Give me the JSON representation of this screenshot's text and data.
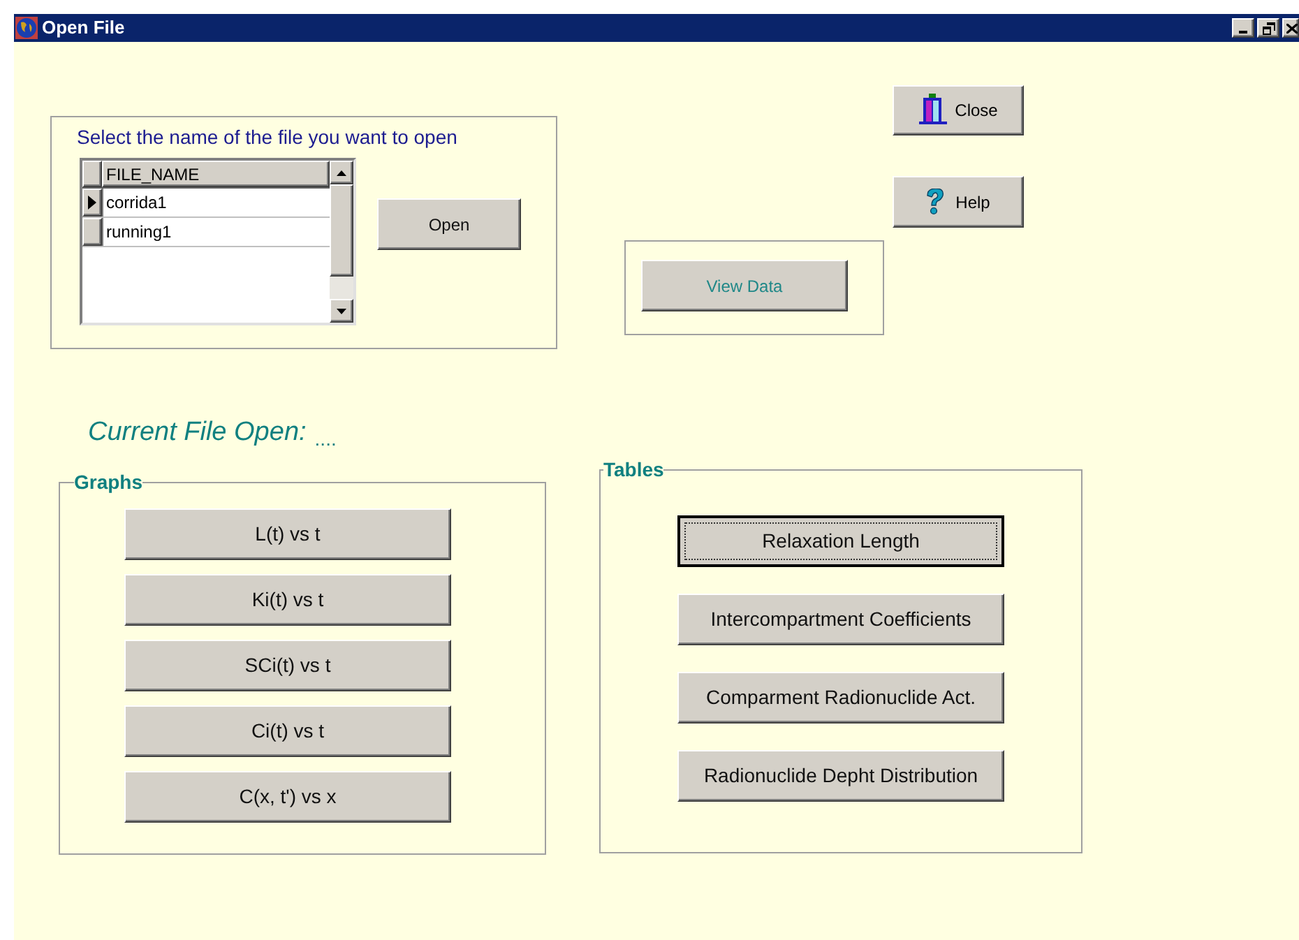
{
  "window": {
    "title": "Open File"
  },
  "file_picker": {
    "prompt": "Select the name of the file you want to open",
    "grid": {
      "columns": [
        "FILE_NAME"
      ],
      "rows": [
        {
          "cells": [
            "corrida1"
          ],
          "selected": true
        },
        {
          "cells": [
            "running1"
          ],
          "selected": false
        }
      ]
    },
    "open_button": "Open"
  },
  "view_data_button": "View Data",
  "close_button": "Close",
  "help_button": "Help",
  "current_file": {
    "label": "Current File Open:",
    "value": "...."
  },
  "graphs": {
    "title": "Graphs",
    "buttons": [
      {
        "label": "L(t) vs t",
        "selected": false
      },
      {
        "label": "Ki(t) vs t",
        "selected": false
      },
      {
        "label": "SCi(t) vs t",
        "selected": false
      },
      {
        "label": "Ci(t) vs t",
        "selected": false
      },
      {
        "label": "C(x, t') vs x",
        "selected": false
      }
    ]
  },
  "tables": {
    "title": "Tables",
    "buttons": [
      {
        "label": "Relaxation Length",
        "selected": true
      },
      {
        "label": "Intercompartment Coefficients",
        "selected": false
      },
      {
        "label": "Comparment Radionuclide Act.",
        "selected": false
      },
      {
        "label": "Radionuclide Depht Distribution",
        "selected": false
      }
    ]
  }
}
